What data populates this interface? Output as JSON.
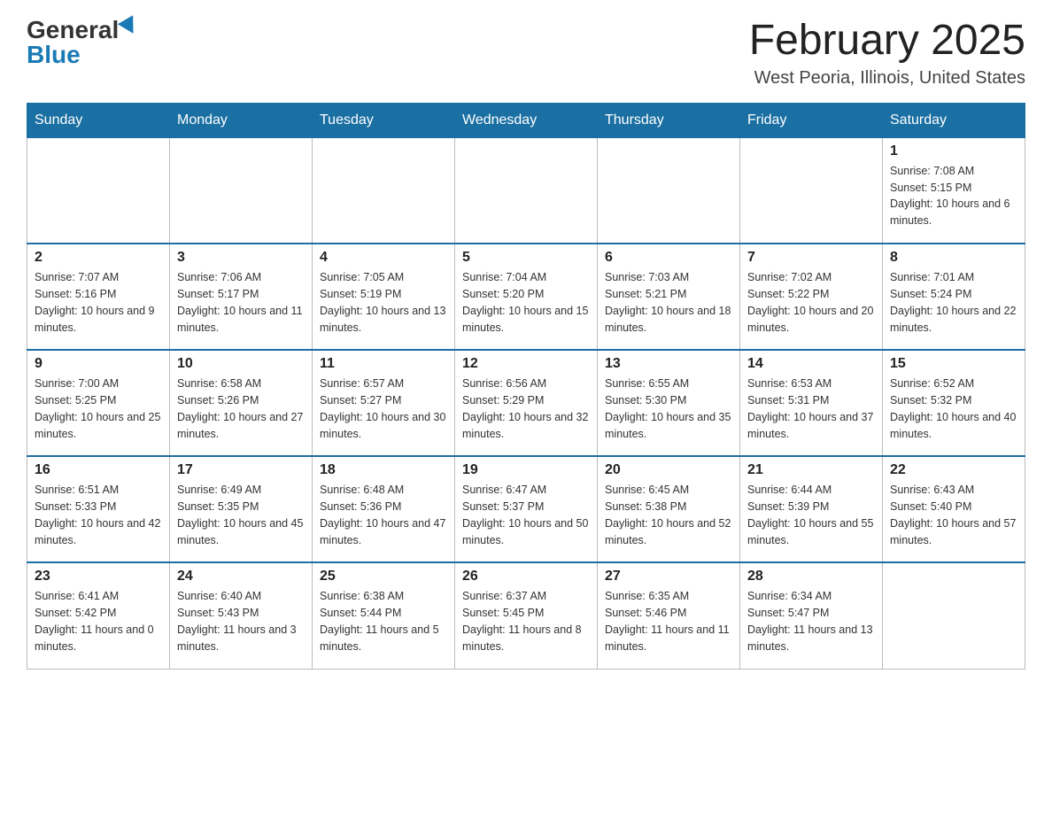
{
  "logo": {
    "general": "General",
    "blue": "Blue"
  },
  "title": "February 2025",
  "subtitle": "West Peoria, Illinois, United States",
  "days_of_week": [
    "Sunday",
    "Monday",
    "Tuesday",
    "Wednesday",
    "Thursday",
    "Friday",
    "Saturday"
  ],
  "weeks": [
    [
      {
        "day": "",
        "sunrise": "",
        "sunset": "",
        "daylight": ""
      },
      {
        "day": "",
        "sunrise": "",
        "sunset": "",
        "daylight": ""
      },
      {
        "day": "",
        "sunrise": "",
        "sunset": "",
        "daylight": ""
      },
      {
        "day": "",
        "sunrise": "",
        "sunset": "",
        "daylight": ""
      },
      {
        "day": "",
        "sunrise": "",
        "sunset": "",
        "daylight": ""
      },
      {
        "day": "",
        "sunrise": "",
        "sunset": "",
        "daylight": ""
      },
      {
        "day": "1",
        "sunrise": "Sunrise: 7:08 AM",
        "sunset": "Sunset: 5:15 PM",
        "daylight": "Daylight: 10 hours and 6 minutes."
      }
    ],
    [
      {
        "day": "2",
        "sunrise": "Sunrise: 7:07 AM",
        "sunset": "Sunset: 5:16 PM",
        "daylight": "Daylight: 10 hours and 9 minutes."
      },
      {
        "day": "3",
        "sunrise": "Sunrise: 7:06 AM",
        "sunset": "Sunset: 5:17 PM",
        "daylight": "Daylight: 10 hours and 11 minutes."
      },
      {
        "day": "4",
        "sunrise": "Sunrise: 7:05 AM",
        "sunset": "Sunset: 5:19 PM",
        "daylight": "Daylight: 10 hours and 13 minutes."
      },
      {
        "day": "5",
        "sunrise": "Sunrise: 7:04 AM",
        "sunset": "Sunset: 5:20 PM",
        "daylight": "Daylight: 10 hours and 15 minutes."
      },
      {
        "day": "6",
        "sunrise": "Sunrise: 7:03 AM",
        "sunset": "Sunset: 5:21 PM",
        "daylight": "Daylight: 10 hours and 18 minutes."
      },
      {
        "day": "7",
        "sunrise": "Sunrise: 7:02 AM",
        "sunset": "Sunset: 5:22 PM",
        "daylight": "Daylight: 10 hours and 20 minutes."
      },
      {
        "day": "8",
        "sunrise": "Sunrise: 7:01 AM",
        "sunset": "Sunset: 5:24 PM",
        "daylight": "Daylight: 10 hours and 22 minutes."
      }
    ],
    [
      {
        "day": "9",
        "sunrise": "Sunrise: 7:00 AM",
        "sunset": "Sunset: 5:25 PM",
        "daylight": "Daylight: 10 hours and 25 minutes."
      },
      {
        "day": "10",
        "sunrise": "Sunrise: 6:58 AM",
        "sunset": "Sunset: 5:26 PM",
        "daylight": "Daylight: 10 hours and 27 minutes."
      },
      {
        "day": "11",
        "sunrise": "Sunrise: 6:57 AM",
        "sunset": "Sunset: 5:27 PM",
        "daylight": "Daylight: 10 hours and 30 minutes."
      },
      {
        "day": "12",
        "sunrise": "Sunrise: 6:56 AM",
        "sunset": "Sunset: 5:29 PM",
        "daylight": "Daylight: 10 hours and 32 minutes."
      },
      {
        "day": "13",
        "sunrise": "Sunrise: 6:55 AM",
        "sunset": "Sunset: 5:30 PM",
        "daylight": "Daylight: 10 hours and 35 minutes."
      },
      {
        "day": "14",
        "sunrise": "Sunrise: 6:53 AM",
        "sunset": "Sunset: 5:31 PM",
        "daylight": "Daylight: 10 hours and 37 minutes."
      },
      {
        "day": "15",
        "sunrise": "Sunrise: 6:52 AM",
        "sunset": "Sunset: 5:32 PM",
        "daylight": "Daylight: 10 hours and 40 minutes."
      }
    ],
    [
      {
        "day": "16",
        "sunrise": "Sunrise: 6:51 AM",
        "sunset": "Sunset: 5:33 PM",
        "daylight": "Daylight: 10 hours and 42 minutes."
      },
      {
        "day": "17",
        "sunrise": "Sunrise: 6:49 AM",
        "sunset": "Sunset: 5:35 PM",
        "daylight": "Daylight: 10 hours and 45 minutes."
      },
      {
        "day": "18",
        "sunrise": "Sunrise: 6:48 AM",
        "sunset": "Sunset: 5:36 PM",
        "daylight": "Daylight: 10 hours and 47 minutes."
      },
      {
        "day": "19",
        "sunrise": "Sunrise: 6:47 AM",
        "sunset": "Sunset: 5:37 PM",
        "daylight": "Daylight: 10 hours and 50 minutes."
      },
      {
        "day": "20",
        "sunrise": "Sunrise: 6:45 AM",
        "sunset": "Sunset: 5:38 PM",
        "daylight": "Daylight: 10 hours and 52 minutes."
      },
      {
        "day": "21",
        "sunrise": "Sunrise: 6:44 AM",
        "sunset": "Sunset: 5:39 PM",
        "daylight": "Daylight: 10 hours and 55 minutes."
      },
      {
        "day": "22",
        "sunrise": "Sunrise: 6:43 AM",
        "sunset": "Sunset: 5:40 PM",
        "daylight": "Daylight: 10 hours and 57 minutes."
      }
    ],
    [
      {
        "day": "23",
        "sunrise": "Sunrise: 6:41 AM",
        "sunset": "Sunset: 5:42 PM",
        "daylight": "Daylight: 11 hours and 0 minutes."
      },
      {
        "day": "24",
        "sunrise": "Sunrise: 6:40 AM",
        "sunset": "Sunset: 5:43 PM",
        "daylight": "Daylight: 11 hours and 3 minutes."
      },
      {
        "day": "25",
        "sunrise": "Sunrise: 6:38 AM",
        "sunset": "Sunset: 5:44 PM",
        "daylight": "Daylight: 11 hours and 5 minutes."
      },
      {
        "day": "26",
        "sunrise": "Sunrise: 6:37 AM",
        "sunset": "Sunset: 5:45 PM",
        "daylight": "Daylight: 11 hours and 8 minutes."
      },
      {
        "day": "27",
        "sunrise": "Sunrise: 6:35 AM",
        "sunset": "Sunset: 5:46 PM",
        "daylight": "Daylight: 11 hours and 11 minutes."
      },
      {
        "day": "28",
        "sunrise": "Sunrise: 6:34 AM",
        "sunset": "Sunset: 5:47 PM",
        "daylight": "Daylight: 11 hours and 13 minutes."
      },
      {
        "day": "",
        "sunrise": "",
        "sunset": "",
        "daylight": ""
      }
    ]
  ]
}
